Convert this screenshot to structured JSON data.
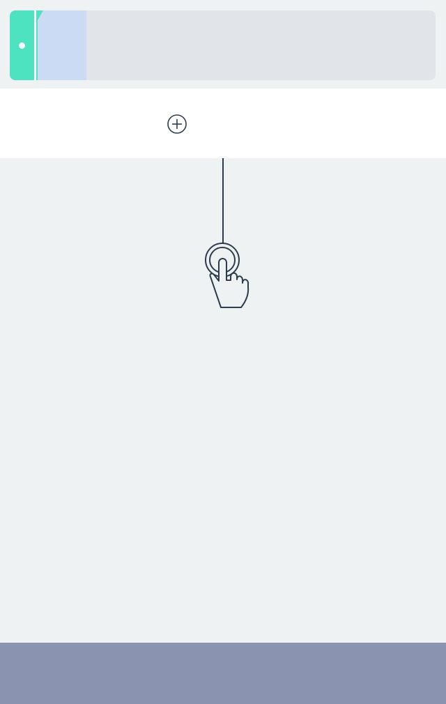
{
  "colors": {
    "background": "#eef2f3",
    "card": "#e1e5e9",
    "accent": "#4ee3c0",
    "highlight": "#cadbf3",
    "row": "#ffffff",
    "icon": "#2d3b4e",
    "bottom_bar": "#8a94b0"
  },
  "icons": {
    "add": "plus-circle-icon",
    "gesture": "tap-hand-icon"
  }
}
